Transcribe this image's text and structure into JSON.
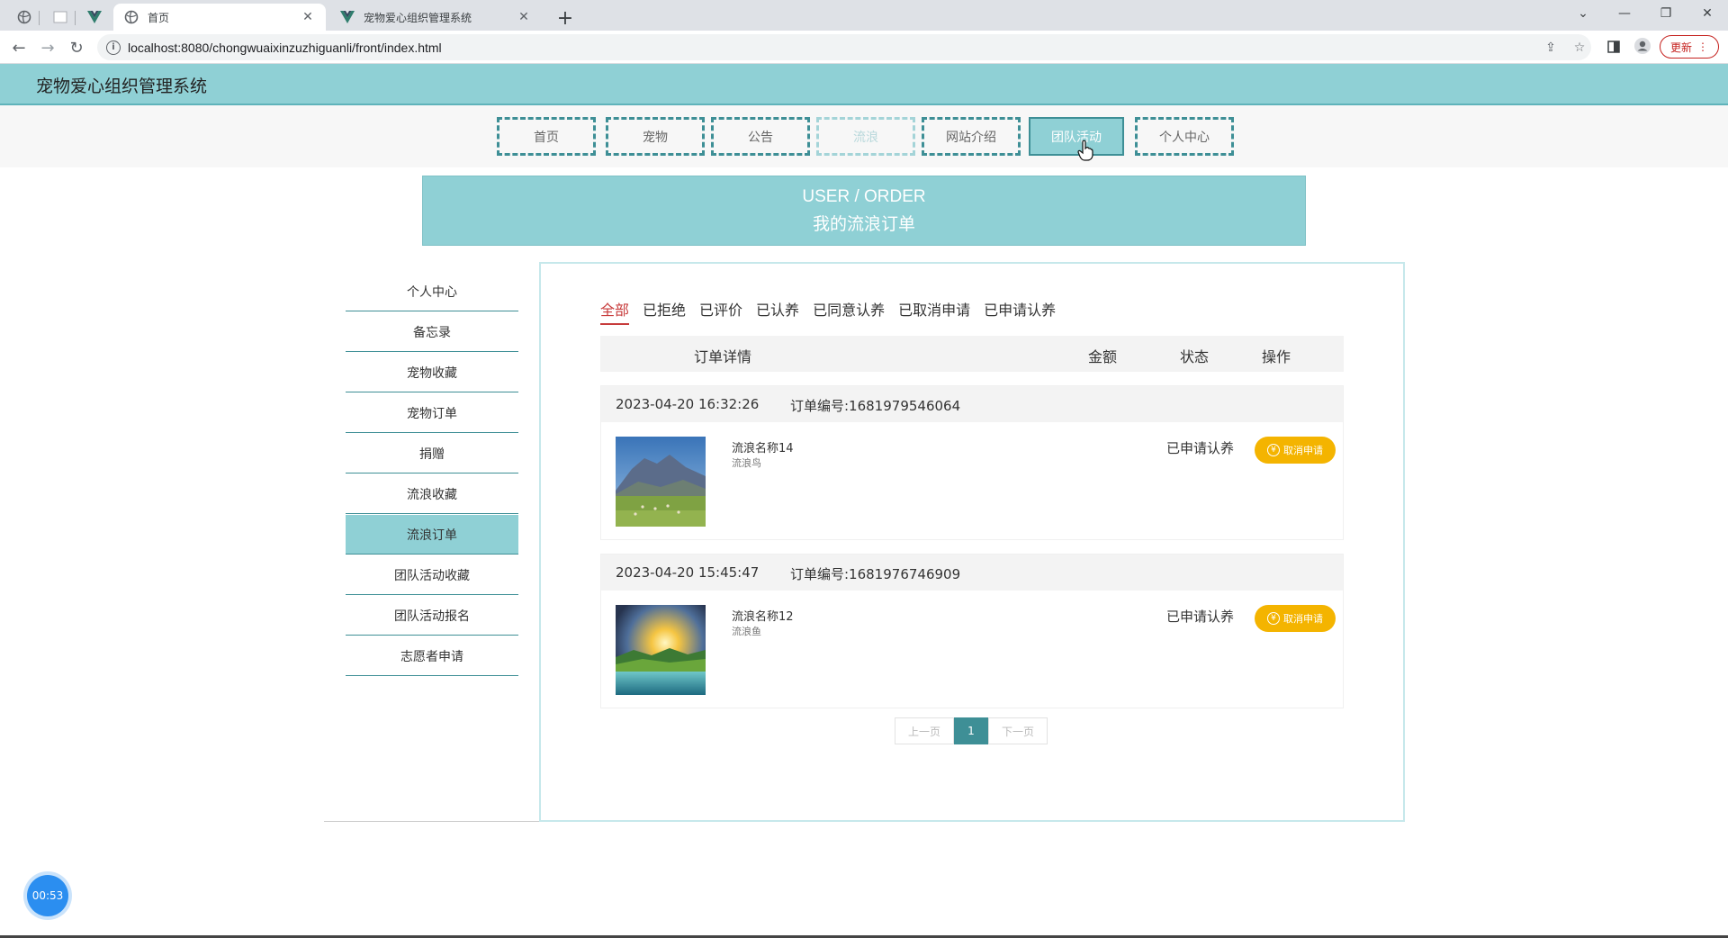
{
  "browser": {
    "tabs": [
      {
        "title": "首页",
        "active": true
      },
      {
        "title": "宠物爱心组织管理系统",
        "active": false
      }
    ],
    "url": "localhost:8080/chongwuaixinzuzhiguanli/front/index.html",
    "update_label": "更新"
  },
  "site": {
    "title": "宠物爱心组织管理系统",
    "nav": [
      {
        "label": "首页"
      },
      {
        "label": "宠物"
      },
      {
        "label": "公告"
      },
      {
        "label": "流浪"
      },
      {
        "label": "网站介绍"
      },
      {
        "label": "团队活动"
      },
      {
        "label": "个人中心"
      }
    ],
    "active_nav": "团队活动"
  },
  "banner": {
    "en": "USER / ORDER",
    "cn": "我的流浪订单"
  },
  "sidebar": {
    "items": [
      {
        "label": "个人中心"
      },
      {
        "label": "备忘录"
      },
      {
        "label": "宠物收藏"
      },
      {
        "label": "宠物订单"
      },
      {
        "label": "捐赠"
      },
      {
        "label": "流浪收藏"
      },
      {
        "label": "流浪订单"
      },
      {
        "label": "团队活动收藏"
      },
      {
        "label": "团队活动报名"
      },
      {
        "label": "志愿者申请"
      }
    ],
    "active": "流浪订单"
  },
  "filters": {
    "tabs": [
      "全部",
      "已拒绝",
      "已评价",
      "已认养",
      "已同意认养",
      "已取消申请",
      "已申请认养"
    ],
    "active": "全部"
  },
  "table": {
    "headers": {
      "detail": "订单详情",
      "amount": "金额",
      "status": "状态",
      "action": "操作"
    }
  },
  "orders": [
    {
      "date": "2023-04-20 16:32:26",
      "order_no": "订单编号:1681979546064",
      "name": "流浪名称14",
      "type": "流浪鸟",
      "status": "已申请认养",
      "action": "取消申请"
    },
    {
      "date": "2023-04-20 15:45:47",
      "order_no": "订单编号:1681976746909",
      "name": "流浪名称12",
      "type": "流浪鱼",
      "status": "已申请认养",
      "action": "取消申请"
    }
  ],
  "pager": {
    "prev": "上一页",
    "current": "1",
    "next": "下一页"
  },
  "timer": "00:53",
  "colors": {
    "accent": "#8fd0d5",
    "accent_dark": "#3e8f96",
    "warn": "#f4b400",
    "active_filter": "#c73b3b"
  }
}
